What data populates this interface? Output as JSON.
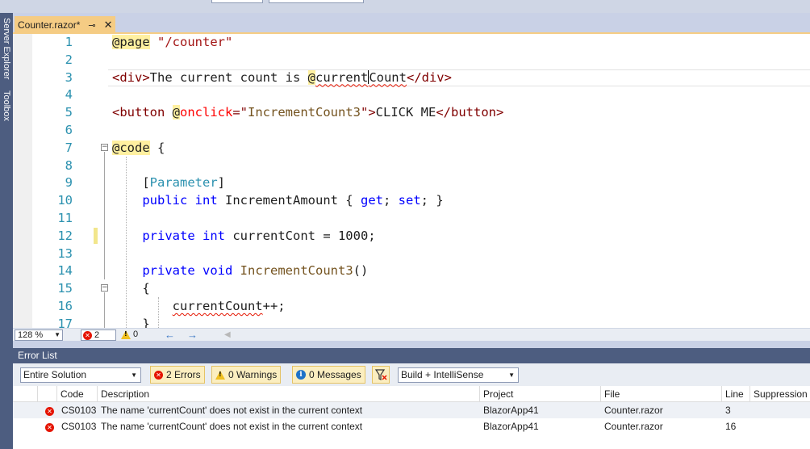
{
  "editor": {
    "tab": {
      "label": "Counter.razor*",
      "pin": "⊸",
      "close": "✕"
    },
    "side_tabs": [
      "Server Explorer",
      "Toolbox"
    ],
    "lines": [
      {
        "no": "1",
        "tokens": [
          {
            "c": "razor",
            "t": "@page"
          },
          {
            "c": "plain",
            "t": " "
          },
          {
            "c": "str",
            "t": "\"/counter\""
          }
        ]
      },
      {
        "no": "2",
        "tokens": []
      },
      {
        "no": "3",
        "tokens": [
          {
            "c": "tag",
            "t": "<div>"
          },
          {
            "c": "plain",
            "t": "The current count is "
          },
          {
            "c": "razor",
            "t": "@"
          },
          {
            "c": "plain squig",
            "t": "current"
          },
          {
            "c": "caret",
            "t": ""
          },
          {
            "c": "plain squig",
            "t": "Count"
          },
          {
            "c": "tag",
            "t": "</div>"
          }
        ]
      },
      {
        "no": "4",
        "tokens": []
      },
      {
        "no": "5",
        "tokens": [
          {
            "c": "tag",
            "t": "<button"
          },
          {
            "c": "plain",
            "t": " "
          },
          {
            "c": "razor",
            "t": "@"
          },
          {
            "c": "attr",
            "t": "onclick"
          },
          {
            "c": "tag",
            "t": "=\""
          },
          {
            "c": "meth",
            "t": "IncrementCount3"
          },
          {
            "c": "tag",
            "t": "\">"
          },
          {
            "c": "plain",
            "t": "CLICK ME"
          },
          {
            "c": "tag",
            "t": "</button>"
          }
        ]
      },
      {
        "no": "6",
        "tokens": []
      },
      {
        "no": "7",
        "tokens": [
          {
            "c": "razor",
            "t": "@code"
          },
          {
            "c": "plain",
            "t": " {"
          }
        ]
      },
      {
        "no": "8",
        "tokens": []
      },
      {
        "no": "9",
        "tokens": [
          {
            "c": "plain",
            "t": "    ["
          },
          {
            "c": "typ",
            "t": "Parameter"
          },
          {
            "c": "plain",
            "t": "]"
          }
        ]
      },
      {
        "no": "10",
        "tokens": [
          {
            "c": "plain",
            "t": "    "
          },
          {
            "c": "kw",
            "t": "public"
          },
          {
            "c": "plain",
            "t": " "
          },
          {
            "c": "kw",
            "t": "int"
          },
          {
            "c": "plain",
            "t": " IncrementAmount { "
          },
          {
            "c": "kw",
            "t": "get"
          },
          {
            "c": "plain",
            "t": "; "
          },
          {
            "c": "kw",
            "t": "set"
          },
          {
            "c": "plain",
            "t": "; }"
          }
        ]
      },
      {
        "no": "11",
        "tokens": []
      },
      {
        "no": "12",
        "tokens": [
          {
            "c": "plain",
            "t": "    "
          },
          {
            "c": "kw",
            "t": "private"
          },
          {
            "c": "plain",
            "t": " "
          },
          {
            "c": "kw",
            "t": "int"
          },
          {
            "c": "plain",
            "t": " currentCont = 1000;"
          }
        ]
      },
      {
        "no": "13",
        "tokens": []
      },
      {
        "no": "14",
        "tokens": [
          {
            "c": "plain",
            "t": "    "
          },
          {
            "c": "kw",
            "t": "private"
          },
          {
            "c": "plain",
            "t": " "
          },
          {
            "c": "kw",
            "t": "void"
          },
          {
            "c": "plain",
            "t": " "
          },
          {
            "c": "meth",
            "t": "IncrementCount3"
          },
          {
            "c": "plain",
            "t": "()"
          }
        ]
      },
      {
        "no": "15",
        "tokens": [
          {
            "c": "plain",
            "t": "    {"
          }
        ]
      },
      {
        "no": "16",
        "tokens": [
          {
            "c": "plain",
            "t": "        "
          },
          {
            "c": "plain squig",
            "t": "currentCount"
          },
          {
            "c": "plain",
            "t": "++;"
          }
        ]
      },
      {
        "no": "17",
        "tokens": [
          {
            "c": "plain",
            "t": "    }"
          }
        ]
      }
    ],
    "status": {
      "zoom": "128 %",
      "error_count": "2",
      "warning_count": "0"
    }
  },
  "error_list": {
    "title": "Error List",
    "scope": "Entire Solution",
    "errors_btn": "2 Errors",
    "warnings_btn": "0 Warnings",
    "messages_btn": "0 Messages",
    "build_filter": "Build + IntelliSense",
    "columns": [
      "Code",
      "Description",
      "Project",
      "File",
      "Line",
      "Suppression S"
    ],
    "rows": [
      {
        "code": "CS0103",
        "description": "The name 'currentCount' does not exist in the current context",
        "project": "BlazorApp41",
        "file": "Counter.razor",
        "line": "3"
      },
      {
        "code": "CS0103",
        "description": "The name 'currentCount' does not exist in the current context",
        "project": "BlazorApp41",
        "file": "Counter.razor",
        "line": "16"
      }
    ]
  },
  "colors": {
    "razor_highlight": "#fff0a0",
    "error": "#e51400",
    "tab_active": "#f5cc84",
    "pane_title": "#4d5d80"
  }
}
